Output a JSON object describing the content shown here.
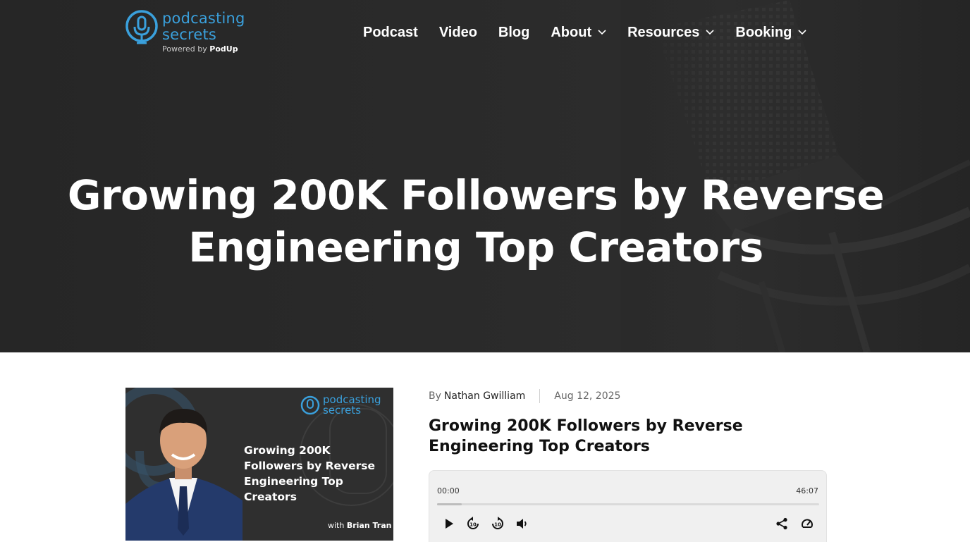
{
  "brand": {
    "word1": "podcasting",
    "word2": "secrets",
    "powered_prefix": "Powered by",
    "powered_name": "PodUp",
    "accent_color": "#3aa0dc"
  },
  "nav": {
    "items": [
      {
        "label": "Podcast",
        "dropdown": false
      },
      {
        "label": "Video",
        "dropdown": false
      },
      {
        "label": "Blog",
        "dropdown": false
      },
      {
        "label": "About",
        "dropdown": true
      },
      {
        "label": "Resources",
        "dropdown": true
      },
      {
        "label": "Booking",
        "dropdown": true
      }
    ]
  },
  "hero": {
    "title": "Growing 200K Followers by Reverse Engineering Top Creators"
  },
  "post": {
    "thumbnail": {
      "logo_line1": "podcasting",
      "logo_line2": "secrets",
      "title": "Growing 200K Followers by Reverse Engineering Top Creators",
      "with_prefix": "with",
      "guest": "Brian Tran"
    },
    "meta": {
      "by": "By",
      "author": "Nathan Gwilliam",
      "date": "Aug 12, 2025"
    },
    "title": "Growing 200K Followers by Reverse Engineering Top Creators",
    "player": {
      "current_time": "00:00",
      "duration": "46:07",
      "progress_fraction": 0.065,
      "controls": [
        "play-icon",
        "rewind-10-icon",
        "forward-10-icon",
        "volume-icon",
        "share-icon",
        "speed-icon"
      ]
    }
  }
}
